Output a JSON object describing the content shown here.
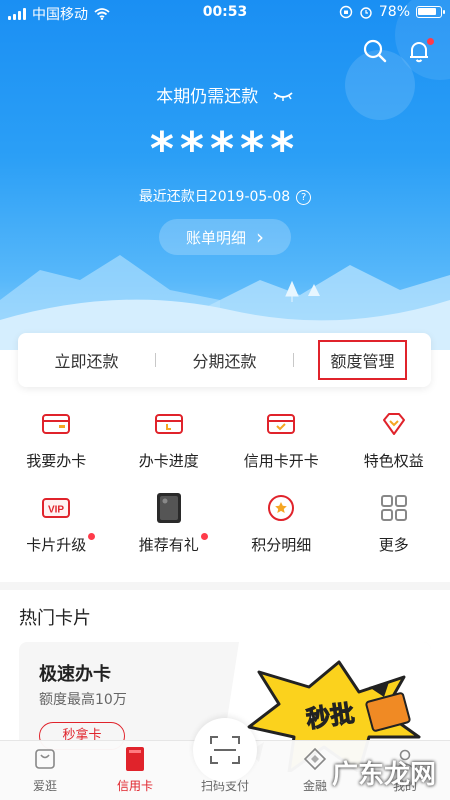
{
  "status_bar": {
    "carrier": "中国移动",
    "time": "00:53",
    "battery": "78%"
  },
  "hero": {
    "title": "本期仍需还款",
    "amount": "*****",
    "due_date": "最近还款日2019-05-08",
    "help_glyph": "?",
    "bill_button": "账单明细",
    "bill_chevron": "›"
  },
  "actions": [
    {
      "label": "立即还款",
      "highlighted": false
    },
    {
      "label": "分期还款",
      "highlighted": false
    },
    {
      "label": "额度管理",
      "highlighted": true
    }
  ],
  "grid": [
    {
      "label": "我要办卡",
      "icon": "card-icon",
      "badge": false
    },
    {
      "label": "办卡进度",
      "icon": "card-progress-icon",
      "badge": false
    },
    {
      "label": "信用卡开卡",
      "icon": "card-activate-icon",
      "badge": false
    },
    {
      "label": "特色权益",
      "icon": "diamond-icon",
      "badge": false
    },
    {
      "label": "卡片升级",
      "icon": "vip-icon",
      "badge": true
    },
    {
      "label": "推荐有礼",
      "icon": "phone-thumbnail-icon",
      "badge": true
    },
    {
      "label": "积分明细",
      "icon": "star-badge-icon",
      "badge": false
    },
    {
      "label": "更多",
      "icon": "grid-icon",
      "badge": false
    }
  ],
  "vip_text": "VIP",
  "hot_cards": {
    "section_title": "热门卡片",
    "card": {
      "title": "极速办卡",
      "subtitle": "额度最高10万",
      "button": "秒拿卡",
      "banner_text": "秒批"
    }
  },
  "tabbar": [
    {
      "label": "爱逛",
      "icon": "bag-icon",
      "active": false
    },
    {
      "label": "信用卡",
      "icon": "credit-card-icon",
      "active": true
    },
    {
      "label": "扫码支付",
      "icon": "scan-icon",
      "active": false
    },
    {
      "label": "金融",
      "icon": "finance-icon",
      "active": false
    },
    {
      "label": "我的",
      "icon": "user-icon",
      "active": false
    }
  ],
  "watermark": "广东龙网",
  "colors": {
    "primary_blue": "#1a8ff3",
    "accent_red": "#e0232b",
    "badge_red": "#ff3b4a"
  }
}
